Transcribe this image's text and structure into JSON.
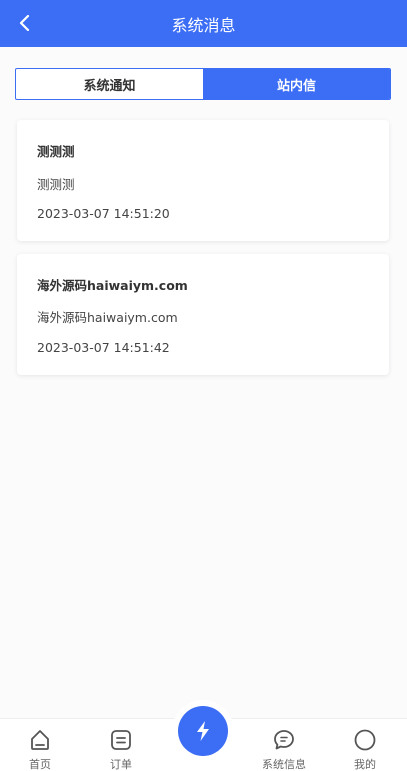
{
  "header": {
    "title": "系统消息"
  },
  "tabs": [
    {
      "label": "系统通知",
      "active": false
    },
    {
      "label": "站内信",
      "active": true
    }
  ],
  "messages": [
    {
      "title": "测测测",
      "body": "测测测",
      "time": "2023-03-07 14:51:20"
    },
    {
      "title": "海外源码haiwaiym.com",
      "body": "海外源码haiwaiym.com",
      "time": "2023-03-07 14:51:42"
    }
  ],
  "tabbar": {
    "home": "首页",
    "orders": "订单",
    "system_info": "系统信息",
    "mine": "我的"
  },
  "colors": {
    "accent": "#3c6ef5",
    "icon": "#555555"
  },
  "icons": {
    "back": "chevron-left-icon",
    "home": "home-icon",
    "orders": "order-icon",
    "center": "lightning-icon",
    "system_info": "chat-bubble-icon",
    "mine": "user-circle-icon"
  }
}
